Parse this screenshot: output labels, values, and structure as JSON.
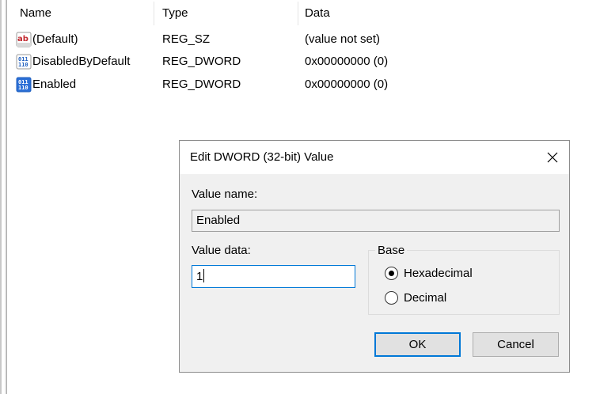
{
  "columns": {
    "name": "Name",
    "type": "Type",
    "data": "Data"
  },
  "rows": [
    {
      "name": "(Default)",
      "type": "REG_SZ",
      "data": "(value not set)",
      "icon": "string-value-icon"
    },
    {
      "name": "DisabledByDefault",
      "type": "REG_DWORD",
      "data": "0x00000000 (0)",
      "icon": "binary-value-icon"
    },
    {
      "name": "Enabled",
      "type": "REG_DWORD",
      "data": "0x00000000 (0)",
      "icon": "binary-value-icon"
    }
  ],
  "dialog": {
    "title": "Edit DWORD (32-bit) Value",
    "value_name_label": "Value name:",
    "value_name": "Enabled",
    "value_data_label": "Value data:",
    "value_data": "1",
    "base_label": "Base",
    "base_options": [
      "Hexadecimal",
      "Decimal"
    ],
    "base_selected": "Hexadecimal",
    "ok_label": "OK",
    "cancel_label": "Cancel"
  },
  "colors": {
    "accent": "#0078d7",
    "dialog_bg": "#f0f0f0",
    "string_icon_red": "#c1272d",
    "binary_icon_blue": "#1f5fbf"
  }
}
